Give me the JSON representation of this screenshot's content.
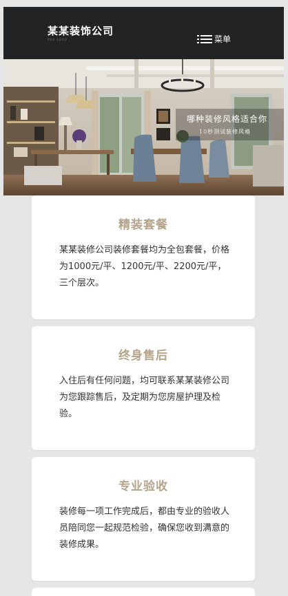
{
  "header": {
    "logo_title": "某某装饰公司",
    "logo_sub": "YOU LOGO",
    "menu_label": "菜单",
    "menu_icon": "list-menu-icon"
  },
  "banner": {
    "headline": "哪种装修风格适合你",
    "subline": "10秒测试装修风格"
  },
  "cards": [
    {
      "title": "精装套餐",
      "text": "某某装修公司装修套餐均为全包套餐，价格为1000元/平、1200元/平、2200元/平，三个层次。"
    },
    {
      "title": "终身售后",
      "text": "入住后有任何问题，均可联系某某装修公司为您跟踪售后，及定期为您房屋护理及检验。"
    },
    {
      "title": "专业验收",
      "text": "装修每一项工作完成后，都由专业的验收人员陪同您一起规范检验，确保您收到满意的装修成果。"
    }
  ],
  "colors": {
    "header_bg": "#222325",
    "card_title": "#b5a48c",
    "page_bg": "#e6e6e6"
  }
}
